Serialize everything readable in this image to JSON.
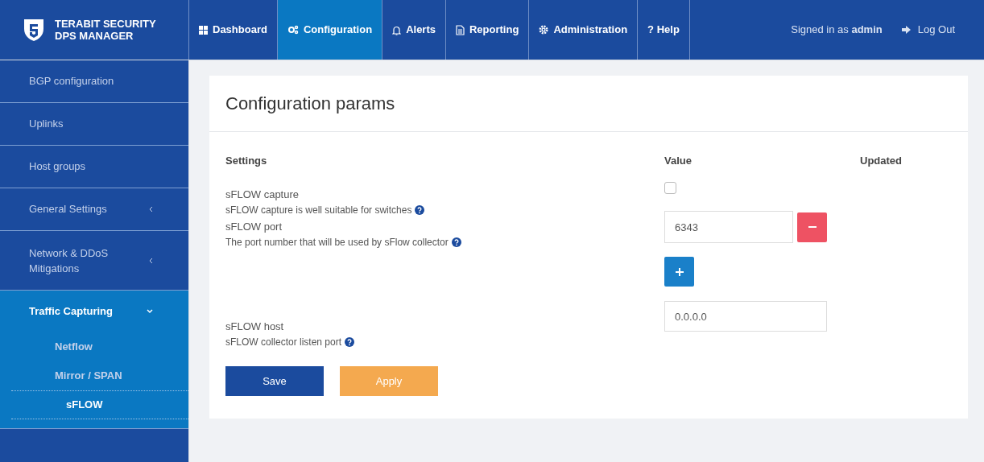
{
  "brand": {
    "line1": "TERABIT SECURITY",
    "line2": "DPS MANAGER"
  },
  "nav": [
    {
      "kind": "grid",
      "label": "Dashboard",
      "selected": false
    },
    {
      "kind": "gears",
      "label": "Configuration",
      "selected": true
    },
    {
      "kind": "bell",
      "label": "Alerts",
      "selected": false
    },
    {
      "kind": "doc",
      "label": "Reporting",
      "selected": false
    },
    {
      "kind": "gear",
      "label": "Administration",
      "selected": false
    },
    {
      "kind": "plain",
      "label": "? Help",
      "selected": false
    }
  ],
  "user": {
    "text": "Signed in as **admin**",
    "logout": "Log Out"
  },
  "sidebar": [
    {
      "label": "BGP configuration",
      "selected": false
    },
    {
      "label": "Uplinks",
      "selected": false
    },
    {
      "label": "Host groups",
      "selected": false
    },
    {
      "label": "General Settings",
      "expanded": false,
      "selected": false
    },
    {
      "label": "Network & DDoS Mitigations",
      "expanded": false,
      "selected": false
    },
    {
      "label": "Traffic Capturing",
      "expanded": true,
      "selected": true,
      "children": [
        {
          "label": "Netflow",
          "selected": false
        },
        {
          "label": "Mirror / SPAN",
          "selected": false
        },
        {
          "label": "sFLOW",
          "selected": true
        }
      ]
    }
  ],
  "card": {
    "title": "Configuration params",
    "columns": [
      "Settings",
      "Value",
      "Updated"
    ],
    "rows": [
      {
        "kind": "checkbox",
        "name": "sFLOW capture",
        "hint": "sFLOW capture is well suitable for switches",
        "checked": false
      },
      {
        "kind": "list",
        "name": "sFLOW port",
        "hint": "The port number that will be used by sFlow collector",
        "values": [
          "6343"
        ]
      },
      {
        "kind": "text",
        "name": "sFLOW host",
        "hint": "sFLOW collector listen port",
        "value": "0.0.0.0"
      }
    ],
    "buttons": [
      {
        "kind": "primary",
        "label": "Save"
      },
      {
        "kind": "warning",
        "label": "Apply"
      }
    ]
  }
}
